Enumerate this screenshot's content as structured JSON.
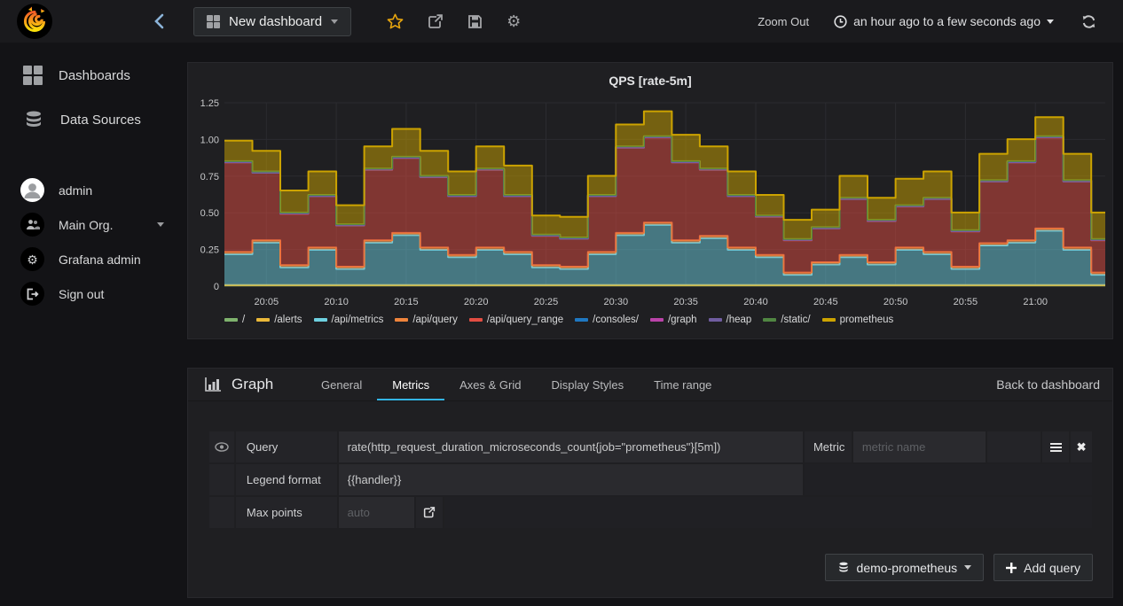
{
  "topbar": {
    "dashboard_title": "New dashboard",
    "zoom_out": "Zoom Out",
    "time_range": "an hour ago to a few seconds ago"
  },
  "sidebar": {
    "nav_items": [
      {
        "icon": "dashboards-grid",
        "label": "Dashboards"
      },
      {
        "icon": "database",
        "label": "Data Sources"
      }
    ],
    "user_items": [
      {
        "icon": "avatar",
        "label": "admin"
      },
      {
        "icon": "users",
        "label": "Main Org."
      },
      {
        "icon": "gear",
        "label": "Grafana admin"
      },
      {
        "icon": "sign-out",
        "label": "Sign out"
      }
    ]
  },
  "graph_panel": {
    "title": "QPS [rate-5m]"
  },
  "chart_data": {
    "type": "area",
    "stacked": true,
    "title": "QPS [rate-5m]",
    "x_start": "20:02",
    "x_step_minutes": 2,
    "x_ticks": [
      "20:05",
      "20:10",
      "20:15",
      "20:20",
      "20:25",
      "20:30",
      "20:35",
      "20:40",
      "20:45",
      "20:50",
      "20:55",
      "21:00"
    ],
    "ylim": [
      0,
      1.25
    ],
    "y_ticks": [
      0,
      0.25,
      0.5,
      0.75,
      1.0,
      1.25
    ],
    "y_tick_labels": [
      "0",
      "0.25",
      "0.50",
      "0.75",
      "1.00",
      "1.25"
    ],
    "legend_position": "bottom",
    "grid": true,
    "series": [
      {
        "name": "/",
        "color": "#7EB26D",
        "flat": 0.004
      },
      {
        "name": "/alerts",
        "color": "#EAB839",
        "flat": 0.004
      },
      {
        "name": "/api/metrics",
        "color": "#6ED0E0",
        "values": [
          0.21,
          0.29,
          0.12,
          0.24,
          0.11,
          0.29,
          0.34,
          0.24,
          0.19,
          0.24,
          0.21,
          0.12,
          0.11,
          0.21,
          0.34,
          0.41,
          0.29,
          0.32,
          0.24,
          0.19,
          0.07,
          0.14,
          0.19,
          0.14,
          0.24,
          0.21,
          0.11,
          0.27,
          0.29,
          0.37,
          0.24,
          0.07
        ]
      },
      {
        "name": "/api/query",
        "color": "#EF843C",
        "flat": 0.015
      },
      {
        "name": "/api/query_range",
        "color": "#E24D42",
        "values": [
          0.61,
          0.46,
          0.35,
          0.35,
          0.28,
          0.48,
          0.51,
          0.48,
          0.4,
          0.53,
          0.38,
          0.2,
          0.19,
          0.38,
          0.58,
          0.58,
          0.53,
          0.45,
          0.35,
          0.26,
          0.22,
          0.23,
          0.38,
          0.28,
          0.28,
          0.36,
          0.24,
          0.42,
          0.53,
          0.62,
          0.45,
          0.22
        ]
      },
      {
        "name": "/consoles/",
        "color": "#1F78C1",
        "flat": 0.002
      },
      {
        "name": "/graph",
        "color": "#BA43A9",
        "flat": 0.002
      },
      {
        "name": "/heap",
        "color": "#705DA0",
        "flat": 0.002
      },
      {
        "name": "/static/",
        "color": "#508642",
        "flat": 0.003
      },
      {
        "name": "prometheus",
        "color": "#CCA300",
        "values": [
          0.14,
          0.14,
          0.15,
          0.16,
          0.13,
          0.15,
          0.19,
          0.17,
          0.16,
          0.15,
          0.2,
          0.13,
          0.14,
          0.13,
          0.15,
          0.17,
          0.18,
          0.15,
          0.16,
          0.14,
          0.13,
          0.12,
          0.15,
          0.15,
          0.18,
          0.18,
          0.12,
          0.18,
          0.15,
          0.13,
          0.18,
          0.18
        ]
      }
    ]
  },
  "editor": {
    "panel_type": "Graph",
    "tabs": [
      "General",
      "Metrics",
      "Axes & Grid",
      "Display Styles",
      "Time range"
    ],
    "active_tab": "Metrics",
    "back_link": "Back to dashboard",
    "rows": {
      "query": {
        "label": "Query",
        "value": "rate(http_request_duration_microseconds_count{job=\"prometheus\"}[5m])",
        "metric_label": "Metric",
        "metric_placeholder": "metric name"
      },
      "legend": {
        "label": "Legend format",
        "value": "{{handler}}"
      },
      "max_points": {
        "label": "Max points",
        "placeholder": "auto"
      }
    },
    "datasource": "demo-prometheus",
    "add_query": "Add query"
  },
  "colors": {
    "active_tab_underline": "#33b5e5",
    "star": "#e7a50e",
    "panel_bg": "#1f1f22",
    "page_bg": "#131316",
    "grid_line": "#2b2b30"
  }
}
